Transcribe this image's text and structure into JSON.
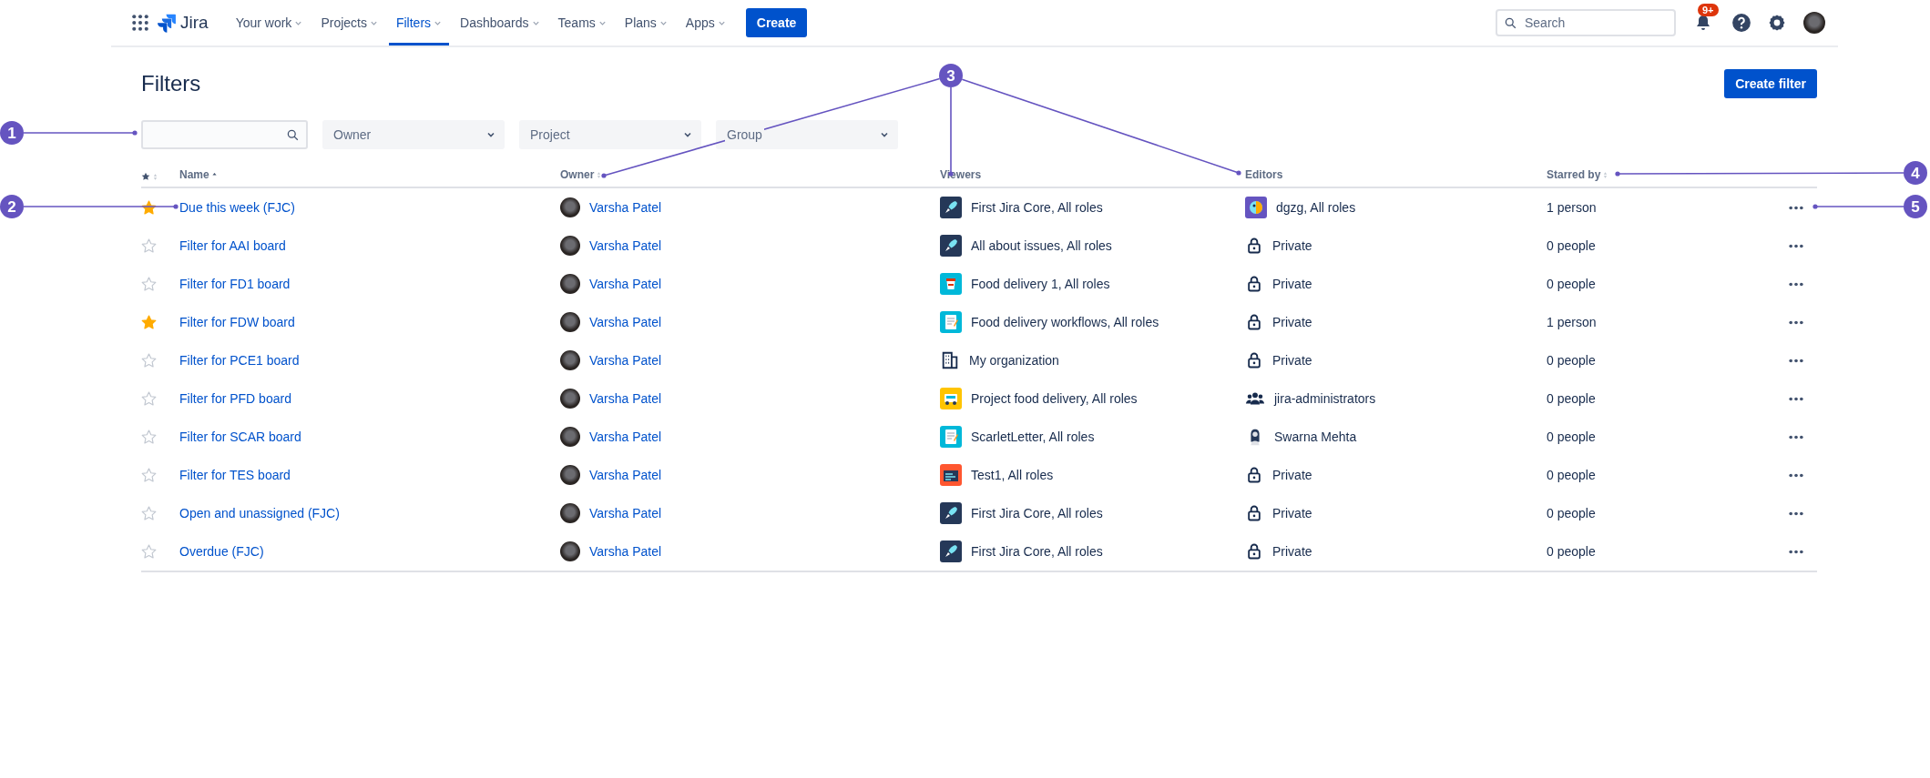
{
  "nav": {
    "product": "Jira",
    "items": [
      {
        "label": "Your work",
        "selected": false
      },
      {
        "label": "Projects",
        "selected": false
      },
      {
        "label": "Filters",
        "selected": true
      },
      {
        "label": "Dashboards",
        "selected": false
      },
      {
        "label": "Teams",
        "selected": false
      },
      {
        "label": "Plans",
        "selected": false
      },
      {
        "label": "Apps",
        "selected": false
      }
    ],
    "create_button": "Create",
    "search": {
      "placeholder": "Search"
    },
    "notification_badge": "9+"
  },
  "page": {
    "title": "Filters",
    "create_filter_button": "Create filter"
  },
  "filter_bar": {
    "dropdowns": [
      {
        "placeholder": "Owner"
      },
      {
        "placeholder": "Project"
      },
      {
        "placeholder": "Group"
      }
    ]
  },
  "table": {
    "columns": [
      "Name",
      "Owner",
      "Viewers",
      "Editors",
      "Starred by"
    ],
    "rows": [
      {
        "starred": true,
        "name": "Due this week (FJC)",
        "owner": "Varsha Patel",
        "viewers": {
          "kind": "rocket",
          "text": "First Jira Core, All roles"
        },
        "editors": {
          "kind": "parrot",
          "text": "dgzg, All roles"
        },
        "starred_by": "1 person"
      },
      {
        "starred": false,
        "name": "Filter for AAI board",
        "owner": "Varsha Patel",
        "viewers": {
          "kind": "rocket",
          "text": "All about issues, All roles"
        },
        "editors": {
          "kind": "lock",
          "text": "Private"
        },
        "starred_by": "0 people"
      },
      {
        "starred": false,
        "name": "Filter for FD1 board",
        "owner": "Varsha Patel",
        "viewers": {
          "kind": "cup",
          "text": "Food delivery 1, All roles"
        },
        "editors": {
          "kind": "lock",
          "text": "Private"
        },
        "starred_by": "0 people"
      },
      {
        "starred": true,
        "name": "Filter for FDW board",
        "owner": "Varsha Patel",
        "viewers": {
          "kind": "notepad",
          "text": "Food delivery workflows, All roles"
        },
        "editors": {
          "kind": "lock",
          "text": "Private"
        },
        "starred_by": "1 person"
      },
      {
        "starred": false,
        "name": "Filter for PCE1 board",
        "owner": "Varsha Patel",
        "viewers": {
          "kind": "building",
          "text": "My organization"
        },
        "editors": {
          "kind": "lock",
          "text": "Private"
        },
        "starred_by": "0 people"
      },
      {
        "starred": false,
        "name": "Filter for PFD board",
        "owner": "Varsha Patel",
        "viewers": {
          "kind": "truck",
          "text": "Project food delivery, All roles"
        },
        "editors": {
          "kind": "group",
          "text": "jira-administrators"
        },
        "starred_by": "0 people"
      },
      {
        "starred": false,
        "name": "Filter for SCAR board",
        "owner": "Varsha Patel",
        "viewers": {
          "kind": "notepad",
          "text": "ScarletLetter, All roles"
        },
        "editors": {
          "kind": "person",
          "text": "Swarna Mehta"
        },
        "starred_by": "0 people"
      },
      {
        "starred": false,
        "name": "Filter for TES board",
        "owner": "Varsha Patel",
        "viewers": {
          "kind": "window",
          "text": "Test1, All roles"
        },
        "editors": {
          "kind": "lock",
          "text": "Private"
        },
        "starred_by": "0 people"
      },
      {
        "starred": false,
        "name": "Open and unassigned (FJC)",
        "owner": "Varsha Patel",
        "viewers": {
          "kind": "rocket",
          "text": "First Jira Core, All roles"
        },
        "editors": {
          "kind": "lock",
          "text": "Private"
        },
        "starred_by": "0 people"
      },
      {
        "starred": false,
        "name": "Overdue (FJC)",
        "owner": "Varsha Patel",
        "viewers": {
          "kind": "rocket",
          "text": "First Jira Core, All roles"
        },
        "editors": {
          "kind": "lock",
          "text": "Private"
        },
        "starred_by": "0 people"
      }
    ]
  },
  "annotations": [
    {
      "label": "1"
    },
    {
      "label": "2"
    },
    {
      "label": "3"
    },
    {
      "label": "4"
    },
    {
      "label": "5"
    }
  ]
}
